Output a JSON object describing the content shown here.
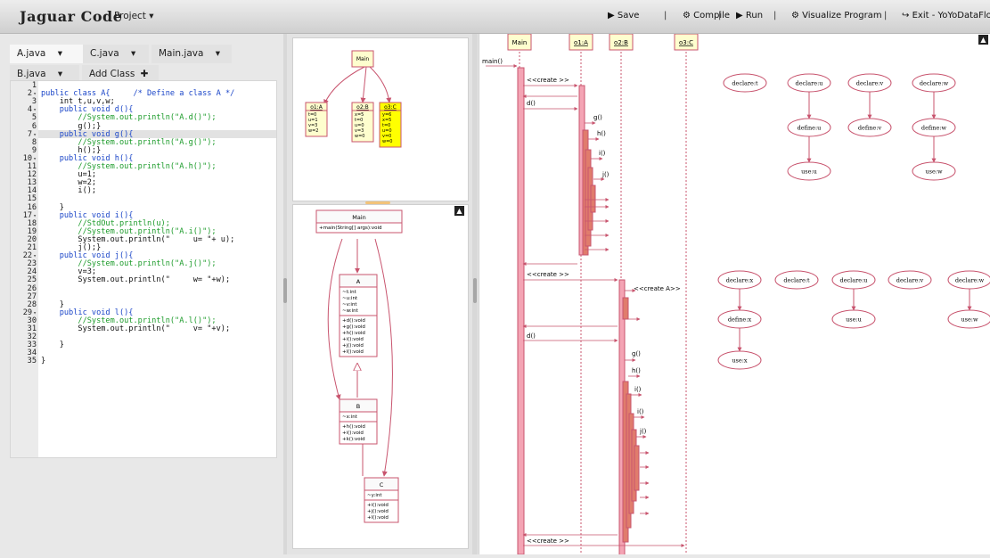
{
  "app": {
    "brand": "Jaguar Code",
    "project_menu": "Project ▾"
  },
  "toolbar": {
    "save": "Save",
    "compile": "Compile",
    "run": "Run",
    "visualize": "Visualize Program",
    "exit": "Exit - YoYoDataFlow",
    "separator": "|"
  },
  "tabs": {
    "a": "A.java",
    "c": "C.java",
    "main": "Main.java",
    "b": "B.java",
    "add": "Add Class",
    "dropdown": "▾",
    "plus": "✚"
  },
  "code": {
    "lines": [
      {
        "n": "1",
        "text": ""
      },
      {
        "n": "2",
        "fold": true,
        "text": "public class A{     /* Define a class A */"
      },
      {
        "n": "3",
        "text": "    int t,u,v,w;"
      },
      {
        "n": "4",
        "fold": true,
        "text": "    public void d(){"
      },
      {
        "n": "5",
        "text": "        //System.out.println(\"A.d()\");"
      },
      {
        "n": "6",
        "text": "        g();}"
      },
      {
        "n": "7",
        "fold": true,
        "text": "    public void g(){"
      },
      {
        "n": "8",
        "text": "        //System.out.println(\"A.g()\");"
      },
      {
        "n": "9",
        "text": "        h();}"
      },
      {
        "n": "10",
        "fold": true,
        "text": "    public void h(){"
      },
      {
        "n": "11",
        "text": "        //System.out.println(\"A.h()\");"
      },
      {
        "n": "12",
        "text": "        u=1;"
      },
      {
        "n": "13",
        "text": "        w=2;"
      },
      {
        "n": "14",
        "text": "        i();"
      },
      {
        "n": "15",
        "text": ""
      },
      {
        "n": "16",
        "text": "    }"
      },
      {
        "n": "17",
        "fold": true,
        "text": "    public void i(){"
      },
      {
        "n": "18",
        "text": "        //StdOut.println(u);"
      },
      {
        "n": "19",
        "text": "        //System.out.println(\"A.i()\");"
      },
      {
        "n": "20",
        "text": "        System.out.println(\"     u= \"+ u);"
      },
      {
        "n": "21",
        "text": "        j();}"
      },
      {
        "n": "22",
        "fold": true,
        "text": "    public void j(){"
      },
      {
        "n": "23",
        "text": "        //System.out.println(\"A.j()\");"
      },
      {
        "n": "24",
        "text": "        v=3;"
      },
      {
        "n": "25",
        "text": "        System.out.println(\"     w= \"+w);"
      },
      {
        "n": "26",
        "text": ""
      },
      {
        "n": "27",
        "text": ""
      },
      {
        "n": "28",
        "text": "    }"
      },
      {
        "n": "29",
        "fold": true,
        "text": "    public void l(){"
      },
      {
        "n": "30",
        "text": "        //System.out.println(\"A.l()\");"
      },
      {
        "n": "31",
        "text": "        System.out.println(\"     v= \"+v);"
      },
      {
        "n": "32",
        "text": ""
      },
      {
        "n": "33",
        "text": "    }"
      },
      {
        "n": "34",
        "text": ""
      },
      {
        "n": "35",
        "text": "}"
      }
    ]
  },
  "object_diagram": {
    "root": "Main",
    "objects": [
      {
        "name": "o1:A",
        "fields": [
          "t=0",
          "u=1",
          "v=3",
          "w=2"
        ]
      },
      {
        "name": "o2:B",
        "fields": [
          "x=5",
          "t=0",
          "u=0",
          "v=3",
          "w=0"
        ]
      },
      {
        "name": "o3:C",
        "fields": [
          "y=6",
          "x=5",
          "t=0",
          "u=0",
          "v=0",
          "w=0"
        ]
      }
    ]
  },
  "class_diagram": {
    "main": {
      "name": "Main",
      "methods": [
        "+main(String[] args):void"
      ]
    },
    "a": {
      "name": "A",
      "fields": [
        "~t:int",
        "~u:int",
        "~v:int",
        "~w:int"
      ],
      "methods": [
        "+d():void",
        "+g():void",
        "+h():void",
        "+i():void",
        "+j():void",
        "+l():void"
      ]
    },
    "b": {
      "name": "B",
      "fields": [
        "~x:int"
      ],
      "methods": [
        "+h():void",
        "+i():void",
        "+k():void"
      ]
    },
    "c": {
      "name": "C",
      "fields": [
        "~y:int"
      ],
      "methods": [
        "+i():void",
        "+j():void",
        "+l():void"
      ]
    }
  },
  "sequence": {
    "lifelines": [
      "Main",
      "o1:A",
      "o2:B",
      "o3:C"
    ],
    "msgs": {
      "main": "main()",
      "create": "<<create >>",
      "createA": "<<create A>>",
      "d": "d()",
      "g": "g()",
      "h": "h()",
      "i": "i()",
      "j": "j()"
    }
  },
  "dataflow": {
    "top_declares": [
      "declare:t",
      "declare:u",
      "declare:v",
      "declare:w"
    ],
    "top_defines": [
      "define:u",
      "define:v",
      "define:w"
    ],
    "top_uses": [
      "use:u",
      "use:w"
    ],
    "bot_declares": [
      "declare:x",
      "declare:t",
      "declare:u",
      "declare:v",
      "declare:w"
    ],
    "bot_defines": [
      "define:x"
    ],
    "bot_uses": [
      "use:x",
      "use:u",
      "use:w"
    ]
  },
  "colors": {
    "accent": "#c8546e",
    "note_fill": "#fefece",
    "highlight_fill": "#ffff00",
    "bar_fill": "#f4a4b4",
    "bar_dark": "#e07c6c"
  },
  "icons": {
    "save": "save-icon",
    "compile": "gear-icon",
    "run": "play-icon",
    "visualize": "gear-icon",
    "exit": "exit-icon"
  }
}
